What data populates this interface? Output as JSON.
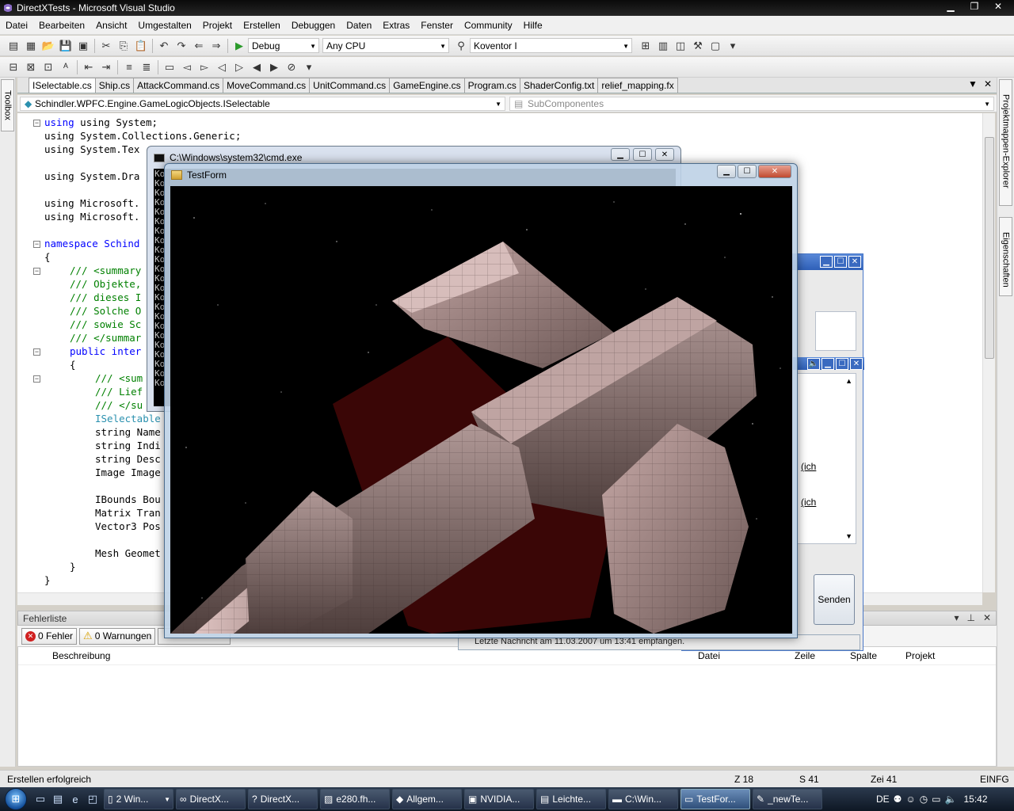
{
  "window": {
    "title": "DirectXTests - Microsoft Visual Studio",
    "minimize": "▁",
    "maximize": "❐",
    "close": "✕"
  },
  "menu": [
    "Datei",
    "Bearbeiten",
    "Ansicht",
    "Umgestalten",
    "Projekt",
    "Erstellen",
    "Debuggen",
    "Daten",
    "Extras",
    "Fenster",
    "Community",
    "Hilfe"
  ],
  "toolbar": {
    "config": "Debug",
    "platform": "Any CPU",
    "find": "Koventor I"
  },
  "side_tabs": {
    "toolbox": "Toolbox",
    "solution_explorer": "Projektmappen-Explorer",
    "properties": "Eigenschaften"
  },
  "doc_tabs": [
    "ISelectable.cs",
    "Ship.cs",
    "AttackCommand.cs",
    "MoveCommand.cs",
    "UnitCommand.cs",
    "GameEngine.cs",
    "Program.cs",
    "ShaderConfig.txt",
    "relief_mapping.fx"
  ],
  "nav": {
    "type_combo": "Schindler.WPFC.Engine.GameLogicObjects.ISelectable",
    "member_combo": "SubComponentes"
  },
  "code": {
    "l1": "using System;",
    "l2": "using System.Collections.Generic;",
    "l3": "using System.Tex",
    "l4": "using System.Dra",
    "l5": "using Microsoft.",
    "l6": "using Microsoft.",
    "l7": "namespace Schind",
    "l8": "{",
    "l9": "/// <summary",
    "l10": "/// Objekte,",
    "l11": "/// dieses I",
    "l12": "/// Solche O",
    "l13": "/// sowie Sc",
    "l14": "/// </summar",
    "l15": "public inter",
    "l16": "{",
    "l17": "/// <sum",
    "l18": "/// Lief",
    "l19": "/// </su",
    "l20": "ISelectable",
    "l21": "string Name",
    "l22": "string Indi",
    "l23": "string Desc",
    "l24": "Image Image",
    "l25": "IBounds Bou",
    "l26": "Matrix Tran",
    "l27": "Vector3 Pos",
    "l28": "Mesh Geomet",
    "l29": "}",
    "l30": "}"
  },
  "cmd": {
    "title": "C:\\Windows\\system32\\cmd.exe",
    "line_prefix": "Ko"
  },
  "testform": {
    "title": "TestForm"
  },
  "messenger": {
    "text1": "(ich",
    "text2": "(ich",
    "send": "Senden",
    "footer": "Letzte Nachricht am 11.03.2007 um 13:41 empfangen."
  },
  "errors": {
    "panel_title": "Fehlerliste",
    "errors_btn": "0 Fehler",
    "warnings_btn": "0 Warnungen",
    "columns": [
      "Beschreibung",
      "Datei",
      "Zeile",
      "Spalte",
      "Projekt"
    ]
  },
  "status": {
    "message": "Erstellen erfolgreich",
    "line": "Z 18",
    "col": "S 41",
    "char": "Zei 41",
    "mode": "EINFG"
  },
  "taskbar": {
    "tasks": [
      "2 Win...",
      "DirectX...",
      "DirectX...",
      "e280.fh...",
      "Allgem...",
      "NVIDIA...",
      "Leichte...",
      "C:\\Win...",
      "TestFor...",
      "_newTe..."
    ],
    "lang": "DE",
    "clock": "15:42"
  }
}
